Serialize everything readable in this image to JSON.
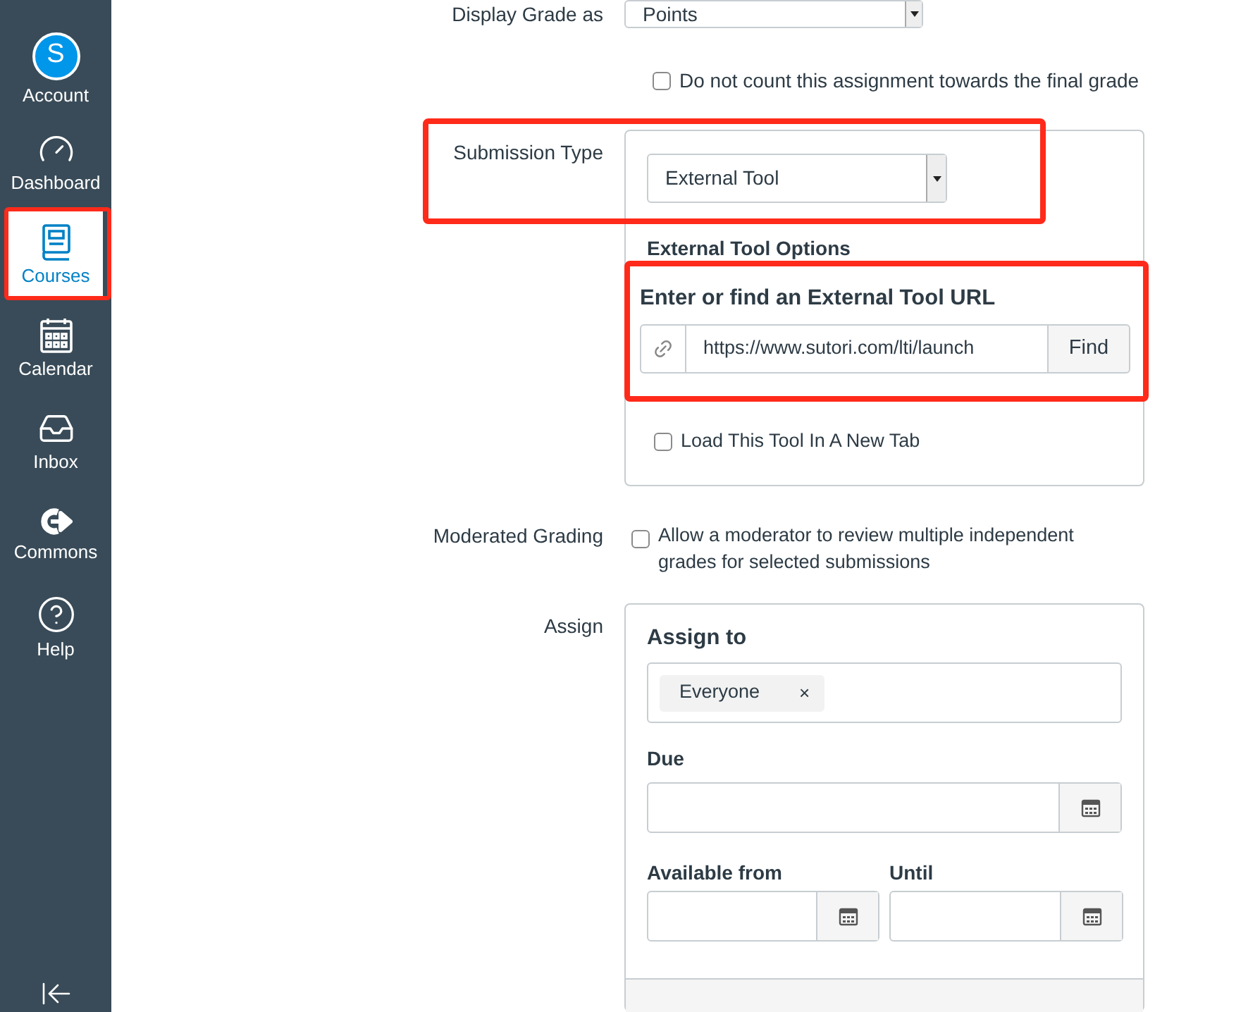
{
  "sidebar": {
    "items": [
      {
        "kind": "account",
        "label": "Account",
        "avatar": "S",
        "selected": false
      },
      {
        "kind": "dashboard",
        "label": "Dashboard",
        "selected": false
      },
      {
        "kind": "courses",
        "label": "Courses",
        "selected": true
      },
      {
        "kind": "calendar",
        "label": "Calendar",
        "selected": false
      },
      {
        "kind": "inbox",
        "label": "Inbox",
        "selected": false
      },
      {
        "kind": "commons",
        "label": "Commons",
        "selected": false
      },
      {
        "kind": "help",
        "label": "Help",
        "selected": false
      }
    ]
  },
  "display_grade": {
    "label": "Display Grade as",
    "value": "Points"
  },
  "exclude_from_final": {
    "label": "Do not count this assignment towards the final grade",
    "checked": false
  },
  "submission_type": {
    "label": "Submission Type",
    "value": "External Tool",
    "options_title": "External Tool Options",
    "url_heading": "Enter or find an External Tool URL",
    "url": "https://www.sutori.com/lti/launch",
    "find_button": "Find",
    "new_tab": {
      "label": "Load This Tool In A New Tab",
      "checked": false
    }
  },
  "moderated_grading": {
    "label": "Moderated Grading",
    "checkbox_label": "Allow a moderator to review multiple independent grades for selected submissions",
    "checked": false
  },
  "assign": {
    "label": "Assign",
    "title": "Assign to",
    "tokens": [
      {
        "label": "Everyone",
        "remove": "×"
      }
    ],
    "due": {
      "label": "Due"
    },
    "available_from": {
      "label": "Available from"
    },
    "until": {
      "label": "Until"
    }
  }
}
